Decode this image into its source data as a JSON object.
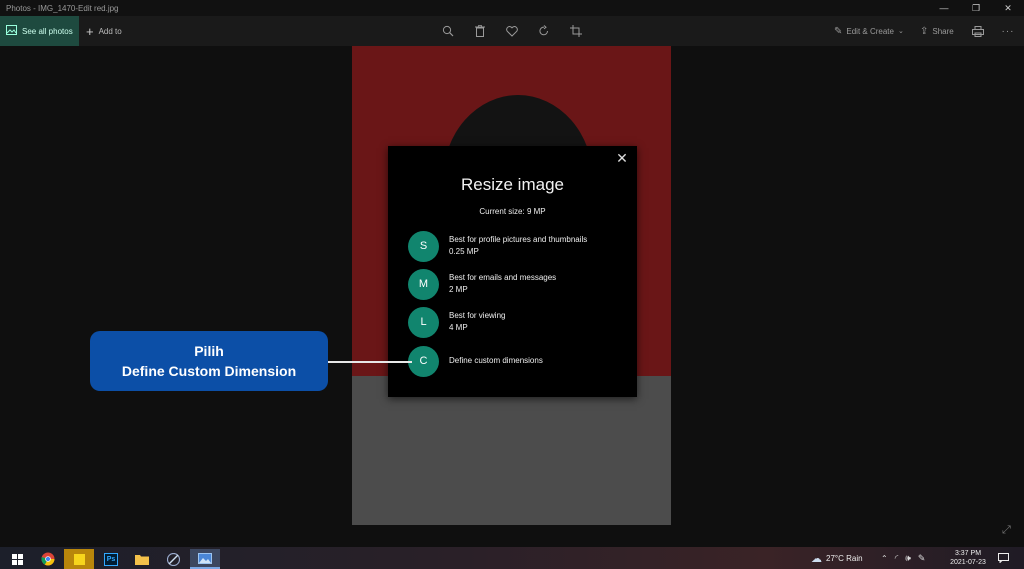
{
  "window": {
    "title": "Photos - IMG_1470-Edit red.jpg",
    "controls": {
      "minimize": "—",
      "maximize": "❐",
      "close": "✕"
    }
  },
  "toolbar": {
    "see_all_label": "See all photos",
    "add_to_label": "Add to",
    "edit_create_label": "Edit & Create",
    "share_label": "Share",
    "icons": [
      "zoom-icon",
      "delete-icon",
      "favorite-icon",
      "rotate-icon",
      "crop-icon",
      "print-icon",
      "more-icon"
    ]
  },
  "dialog": {
    "title": "Resize image",
    "current_size": "Current size: 9 MP",
    "close_glyph": "✕",
    "options": [
      {
        "badge": "S",
        "line1": "Best for profile pictures and thumbnails",
        "line2": "0.25 MP"
      },
      {
        "badge": "M",
        "line1": "Best for emails and messages",
        "line2": "2 MP"
      },
      {
        "badge": "L",
        "line1": "Best for viewing",
        "line2": "4 MP"
      },
      {
        "badge": "C",
        "line1": "Define custom dimensions",
        "line2": ""
      }
    ],
    "accent_color": "#11856e"
  },
  "callout": {
    "line1": "Pilih",
    "line2": "Define Custom Dimension",
    "color": "#0c4fa7"
  },
  "taskbar": {
    "apps": [
      "start-icon",
      "chrome-icon",
      "sticky-notes-icon",
      "photoshop-icon",
      "file-explorer-icon",
      "wifi-tool-icon",
      "photos-icon"
    ],
    "photoshop_label": "Ps",
    "weather": "27°C  Rain",
    "time": "3:37 PM",
    "date": "2021-07-23"
  }
}
